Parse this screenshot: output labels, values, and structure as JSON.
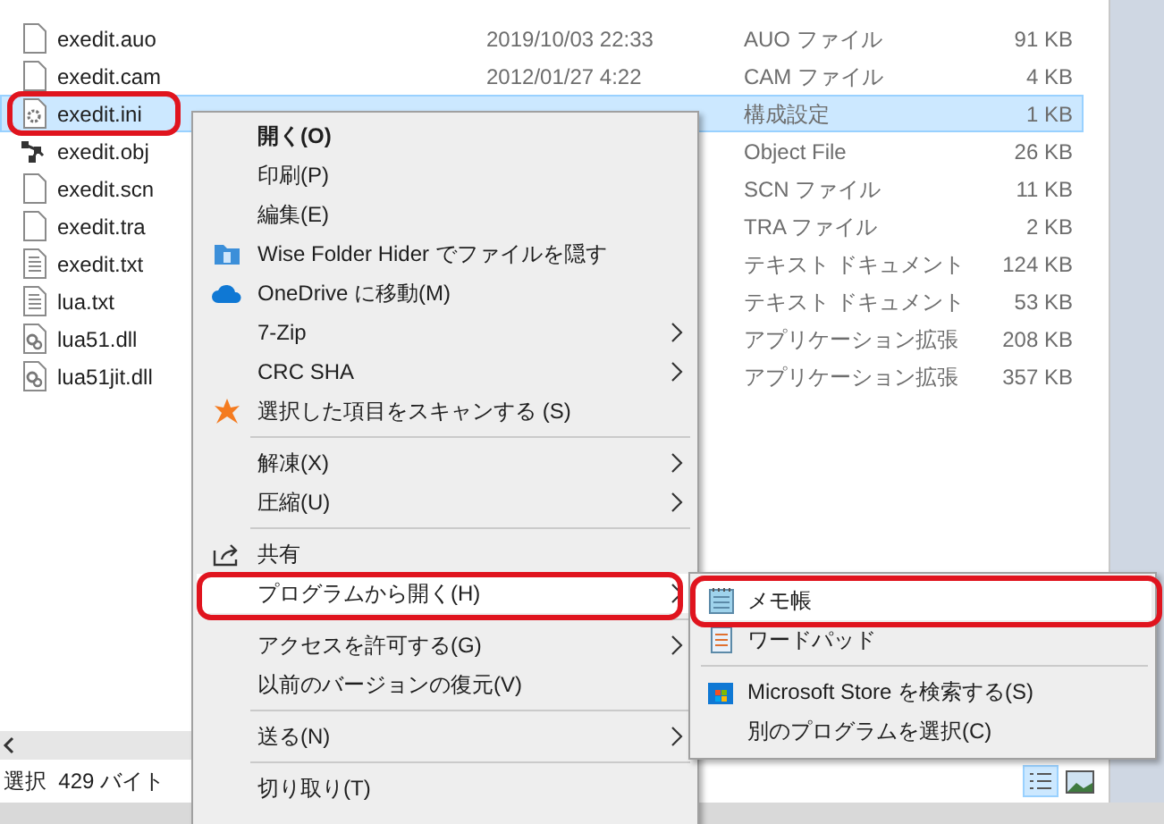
{
  "files": [
    {
      "name": "exedit.auo",
      "date": "2019/10/03 22:33",
      "type": "AUO ファイル",
      "size": "91 KB",
      "kind": "blank",
      "selected": false
    },
    {
      "name": "exedit.cam",
      "date": "2012/01/27 4:22",
      "type": "CAM ファイル",
      "size": "4 KB",
      "kind": "blank",
      "selected": false
    },
    {
      "name": "exedit.ini",
      "type": "構成設定",
      "size": "1 KB",
      "kind": "settings",
      "selected": true
    },
    {
      "name": "exedit.obj",
      "type": "Object File",
      "size": "26 KB",
      "kind": "object",
      "selected": false
    },
    {
      "name": "exedit.scn",
      "type": "SCN ファイル",
      "size": "11 KB",
      "kind": "blank",
      "selected": false
    },
    {
      "name": "exedit.tra",
      "type": "TRA ファイル",
      "size": "2 KB",
      "kind": "blank",
      "selected": false
    },
    {
      "name": "exedit.txt",
      "type": "テキスト ドキュメント",
      "size": "124 KB",
      "kind": "text",
      "selected": false
    },
    {
      "name": "lua.txt",
      "type": "テキスト ドキュメント",
      "size": "53 KB",
      "kind": "text",
      "selected": false
    },
    {
      "name": "lua51.dll",
      "type": "アプリケーション拡張",
      "size": "208 KB",
      "kind": "library",
      "selected": false
    },
    {
      "name": "lua51jit.dll",
      "type": "アプリケーション拡張",
      "size": "357 KB",
      "kind": "library",
      "selected": false
    }
  ],
  "status_bar": {
    "text": "選択  429 バイト"
  },
  "context_menu": [
    {
      "kind": "item",
      "label": "開く(O)",
      "bold": true,
      "submenu": false,
      "selected": false
    },
    {
      "kind": "item",
      "label": "印刷(P)",
      "bold": false,
      "submenu": false,
      "selected": false
    },
    {
      "kind": "item",
      "label": "編集(E)",
      "bold": false,
      "submenu": false,
      "selected": false
    },
    {
      "kind": "item",
      "label": "Wise Folder Hider でファイルを隠す",
      "bold": false,
      "submenu": false,
      "selected": false
    },
    {
      "kind": "item",
      "label": "OneDrive に移動(M)",
      "bold": false,
      "submenu": false,
      "selected": false
    },
    {
      "kind": "item",
      "label": "7-Zip",
      "bold": false,
      "submenu": true,
      "selected": false
    },
    {
      "kind": "item",
      "label": "CRC SHA",
      "bold": false,
      "submenu": true,
      "selected": false
    },
    {
      "kind": "item",
      "label": "選択した項目をスキャンする (S)",
      "bold": false,
      "submenu": false,
      "selected": false
    },
    {
      "kind": "separator"
    },
    {
      "kind": "item",
      "label": "解凍(X)",
      "bold": false,
      "submenu": true,
      "selected": false
    },
    {
      "kind": "item",
      "label": "圧縮(U)",
      "bold": false,
      "submenu": true,
      "selected": false
    },
    {
      "kind": "separator"
    },
    {
      "kind": "item",
      "label": "共有",
      "bold": false,
      "submenu": false,
      "selected": false
    },
    {
      "kind": "item",
      "label": "プログラムから開く(H)",
      "bold": false,
      "submenu": true,
      "selected": true
    },
    {
      "kind": "separator"
    },
    {
      "kind": "item",
      "label": "アクセスを許可する(G)",
      "bold": false,
      "submenu": true,
      "selected": false
    },
    {
      "kind": "item",
      "label": "以前のバージョンの復元(V)",
      "bold": false,
      "submenu": false,
      "selected": false
    },
    {
      "kind": "separator"
    },
    {
      "kind": "item",
      "label": "送る(N)",
      "bold": false,
      "submenu": true,
      "selected": false
    },
    {
      "kind": "separator"
    },
    {
      "kind": "item",
      "label": "切り取り(T)",
      "bold": false,
      "submenu": false,
      "selected": false
    }
  ],
  "open_with_menu": [
    {
      "kind": "item",
      "label": "メモ帳",
      "selected": true
    },
    {
      "kind": "item",
      "label": "ワードパッド",
      "selected": false
    },
    {
      "kind": "separator"
    },
    {
      "kind": "item",
      "label": "Microsoft Store を検索する(S)",
      "selected": false
    },
    {
      "kind": "item",
      "label": "別のプログラムを選択(C)",
      "selected": false
    }
  ]
}
